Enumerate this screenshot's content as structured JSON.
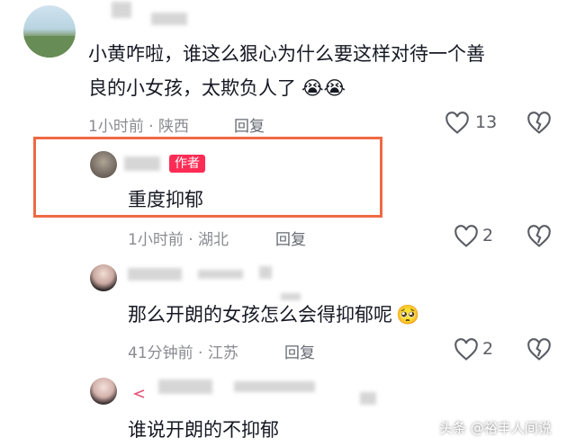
{
  "comments": [
    {
      "text_line1": "小黄咋啦，谁这么狠心为什么要这样对待一个善",
      "text_line2": "良的小女孩，太欺负人了",
      "emoji": "😭😭",
      "time": "1小时前 · 陕西",
      "reply": "回复",
      "likes": "13"
    },
    {
      "badge": "作者",
      "text": "重度抑郁",
      "time": "1小时前 · 湖北",
      "reply": "回复",
      "likes": "2"
    },
    {
      "text": "那么开朗的女孩怎么会得抑郁呢",
      "emoji": "🥺",
      "time": "41分钟前 · 江苏",
      "reply": "回复",
      "likes": "2"
    },
    {
      "text": "谁说开朗的不抑郁"
    }
  ],
  "watermark": "头条 @裕丰人间说",
  "colors": {
    "highlight_border": "#ee6a43",
    "badge_bg": "#fe2c55"
  },
  "icons": [
    "heart-outline-icon",
    "broken-heart-icon"
  ]
}
